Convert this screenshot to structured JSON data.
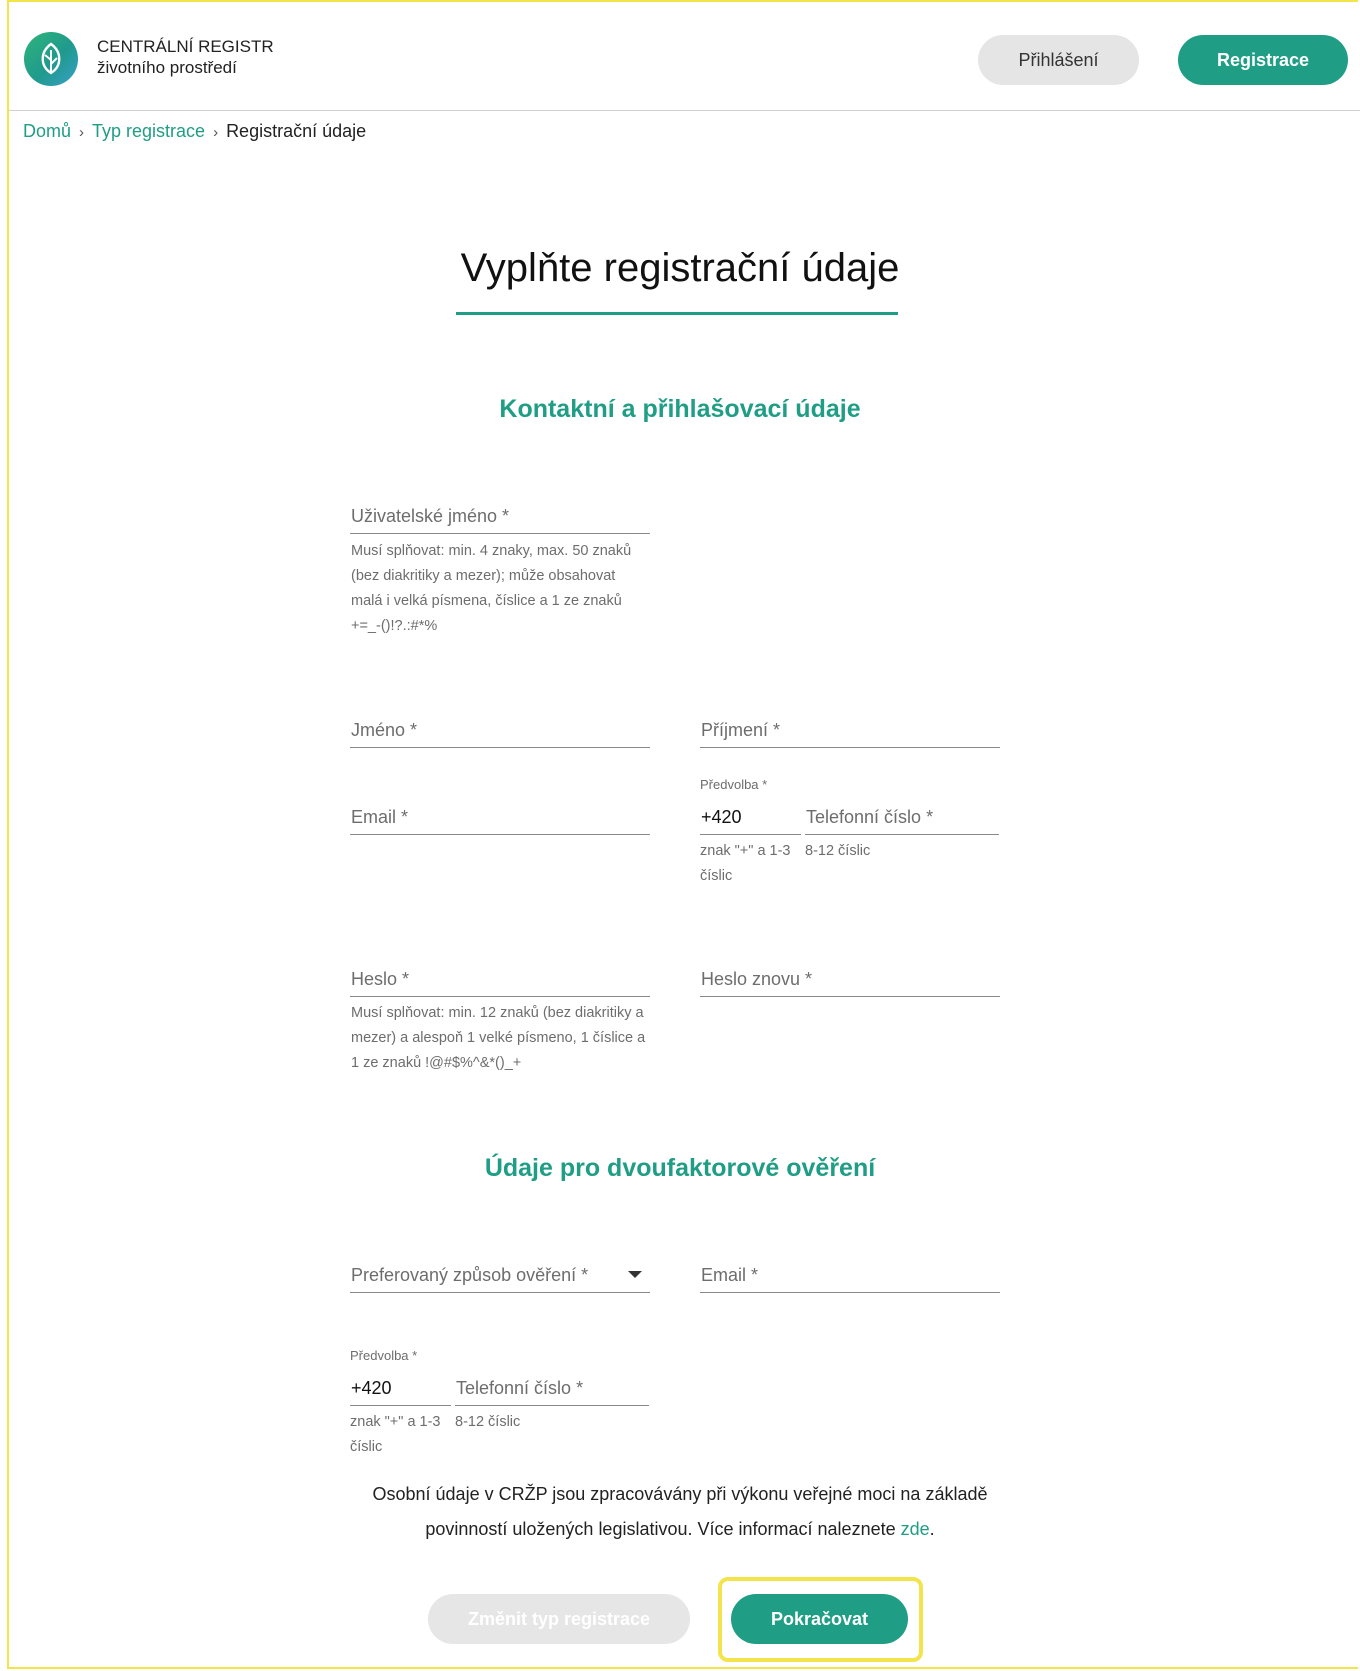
{
  "header": {
    "logo_line1": "CENTRÁLNÍ REGISTR",
    "logo_line2": "životního prostředí",
    "login_label": "Přihlášení",
    "register_label": "Registrace"
  },
  "breadcrumb": {
    "items": [
      "Domů",
      "Typ registrace"
    ],
    "current": "Registrační údaje"
  },
  "page_title": "Vyplňte registrační údaje",
  "contact_section": {
    "title": "Kontaktní a přihlašovací údaje",
    "username_label": "Uživatelské jméno *",
    "username_hint": "Musí splňovat: min. 4 znaky, max. 50 znaků (bez diakritiky a mezer); může obsahovat malá i velká písmena, číslice a 1 ze znaků +=_-()!?.:#*%",
    "first_name_label": "Jméno *",
    "last_name_label": "Příjmení *",
    "email_label": "Email *",
    "prefix_small_label": "Předvolba *",
    "prefix_value": "+420",
    "phone_label": "Telefonní číslo *",
    "prefix_hint": "znak \"+\" a 1-3 číslic",
    "phone_hint": "8-12 číslic",
    "password_label": "Heslo *",
    "password_hint": "Musí splňovat: min. 12 znaků (bez diakritiky a mezer) a alespoň 1 velké písmeno, 1 číslice a 1 ze znaků !@#$%^&*()_+",
    "password_repeat_label": "Heslo znovu *"
  },
  "twofactor_section": {
    "title": "Údaje pro dvoufaktorové ověření",
    "method_label": "Preferovaný způsob ověření *",
    "email_label": "Email *",
    "prefix_small_label": "Předvolba *",
    "prefix_value": "+420",
    "phone_label": "Telefonní číslo *",
    "prefix_hint": "znak \"+\" a 1-3 číslic",
    "phone_hint": "8-12 číslic"
  },
  "privacy": {
    "text": "Osobní údaje v CRŽP jsou zpracovávány při výkonu veřejné moci na základě povinností uložených legislativou. Více informací naleznete",
    "link": "zde",
    "end": "."
  },
  "actions": {
    "change_label": "Změnit typ registrace",
    "continue_label": "Pokračovat"
  },
  "colors": {
    "accent": "#1f9e85",
    "highlight": "#f2e44a"
  }
}
